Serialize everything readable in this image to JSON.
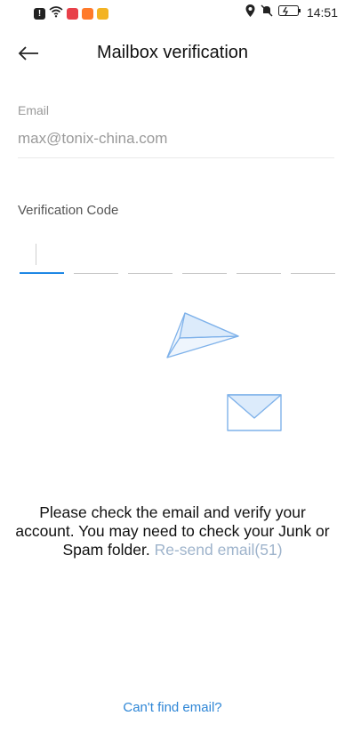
{
  "status_bar": {
    "time": "14:51",
    "left_icons": [
      "alert-icon",
      "wifi-icon",
      "app-red-icon",
      "app-orange-icon",
      "app-yellow-icon"
    ],
    "right_icons": [
      "location-icon",
      "mute-icon",
      "battery-icon"
    ]
  },
  "header": {
    "title": "Mailbox verification"
  },
  "email": {
    "label": "Email",
    "value": "max@tonix-china.com"
  },
  "verification": {
    "label": "Verification Code",
    "digits": [
      "",
      "",
      "",
      "",
      "",
      ""
    ],
    "active_index": 0
  },
  "message": {
    "text": "Please check the email and verify your account. You may need to check your Junk or Spam folder.",
    "resend_label": "Re-send email(51)"
  },
  "footer": {
    "cant_find": "Can't find email?"
  },
  "colors": {
    "accent": "#1e88e5",
    "link": "#2e86d6",
    "resend": "#9fb4cc",
    "illustration": "#7fb2ea"
  }
}
